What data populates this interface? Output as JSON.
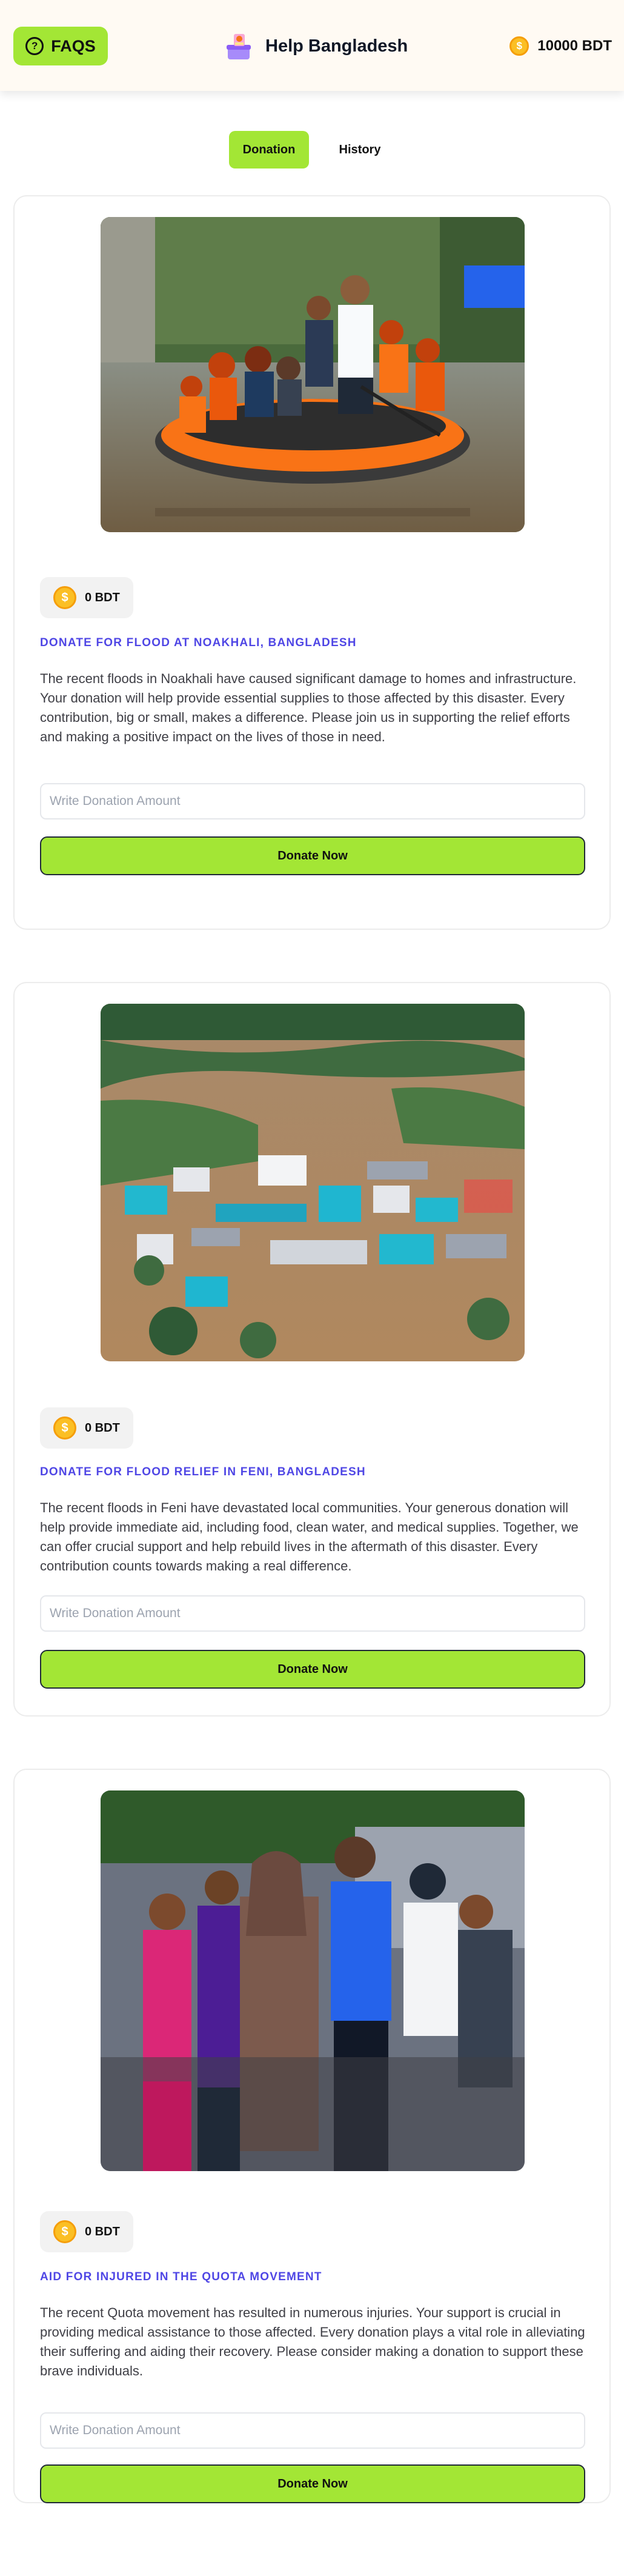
{
  "header": {
    "faq_label": "FAQS",
    "brand_title": "Help Bangladesh",
    "balance": "10000 BDT"
  },
  "tabs": [
    {
      "label": "Donation",
      "active": true
    },
    {
      "label": "History",
      "active": false
    }
  ],
  "coin_symbol": "$",
  "cards": [
    {
      "amount": "0 BDT",
      "title": "Donate for Flood at Noakhali, Bangladesh",
      "description": "The recent floods in Noakhali have caused significant damage to homes and infrastructure. Your donation will help provide essential supplies to those affected by this disaster. Every contribution, big or small, makes a difference. Please join us in supporting the relief efforts and making a positive impact on the lives of those in need.",
      "input_placeholder": "Write Donation Amount",
      "button_label": "Donate Now",
      "image": "flood-rescue-boat-photo"
    },
    {
      "amount": "0 BDT",
      "title": "Donate for Flood Relief in Feni, Bangladesh",
      "description": "The recent floods in Feni have devastated local communities. Your generous donation will help provide immediate aid, including food, clean water, and medical supplies. Together, we can offer crucial support and help rebuild lives in the aftermath of this disaster. Every contribution counts towards making a real difference.",
      "input_placeholder": "Write Donation Amount",
      "button_label": "Donate Now",
      "image": "aerial-flooded-town-photo"
    },
    {
      "amount": "0 BDT",
      "title": "Aid for Injured in the Quota Movement",
      "description": "The recent Quota movement has resulted in numerous injuries. Your support is crucial in providing medical assistance to those affected. Every donation plays a vital role in alleviating their suffering and aiding their recovery. Please consider making a donation to support these brave individuals.",
      "input_placeholder": "Write Donation Amount",
      "button_label": "Donate Now",
      "image": "crowd-protest-photo"
    }
  ]
}
